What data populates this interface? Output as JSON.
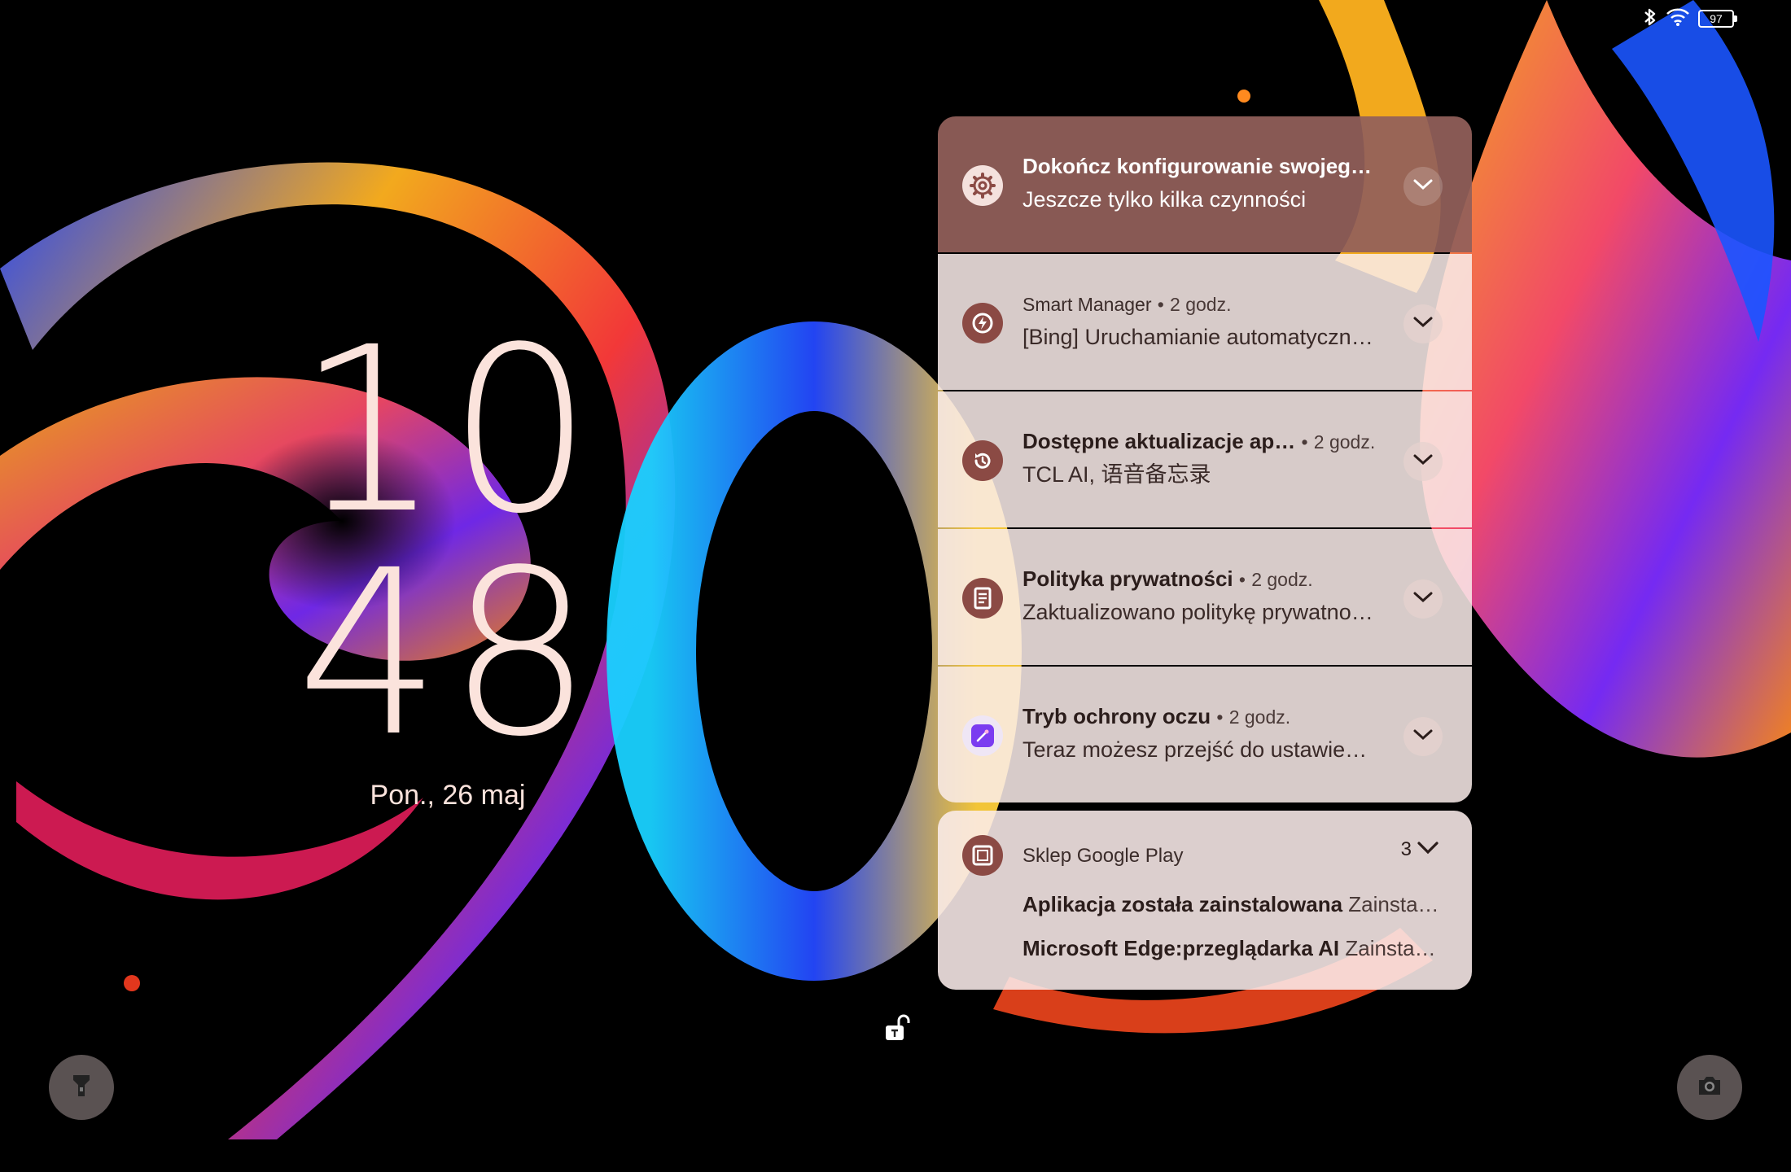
{
  "status_bar": {
    "icons": [
      "bluetooth-icon",
      "wifi-icon",
      "battery-icon"
    ],
    "battery_level": "97"
  },
  "clock": {
    "hours": "10",
    "minutes": "48",
    "date": "Pon., 26 maj"
  },
  "notifications": [
    {
      "icon": "gear-icon",
      "title": "Dokończ konfigurowanie swojeg…",
      "body": "Jeszcze tylko kilka czynności"
    },
    {
      "icon": "smart-manager-icon",
      "app": "Smart Manager",
      "time": "2 godz.",
      "body": "[Bing] Uruchamianie automatyczn…"
    },
    {
      "icon": "update-icon",
      "title": "Dostępne aktualizacje ap…",
      "time": "2 godz.",
      "body": "TCL AI, 语音备忘录"
    },
    {
      "icon": "privacy-document-icon",
      "title": "Polityka prywatności",
      "time": "2 godz.",
      "body": "Zaktualizowano politykę prywatno…"
    },
    {
      "icon": "eye-protection-icon",
      "title": "Tryb ochrony oczu",
      "time": "2 godz.",
      "body": "Teraz możesz przejść do ustawie…"
    }
  ],
  "group": {
    "icon": "google-play-store-icon",
    "app": "Sklep Google Play",
    "count": "3",
    "items": [
      {
        "title": "Aplikacja została zainstalowana",
        "body": "Zainsta…"
      },
      {
        "title": "Microsoft Edge:przeglądarka AI",
        "body": "Zainsta…"
      }
    ]
  },
  "separator": "•",
  "bottom": {
    "left_icon": "flashlight-icon",
    "center_icon": "unlock-icon",
    "right_icon": "camera-icon"
  },
  "colors": {
    "accent": "#8b4a44",
    "first_card": "#92605a",
    "card": "#faeceb",
    "clock_text": "#fbe3dc"
  }
}
